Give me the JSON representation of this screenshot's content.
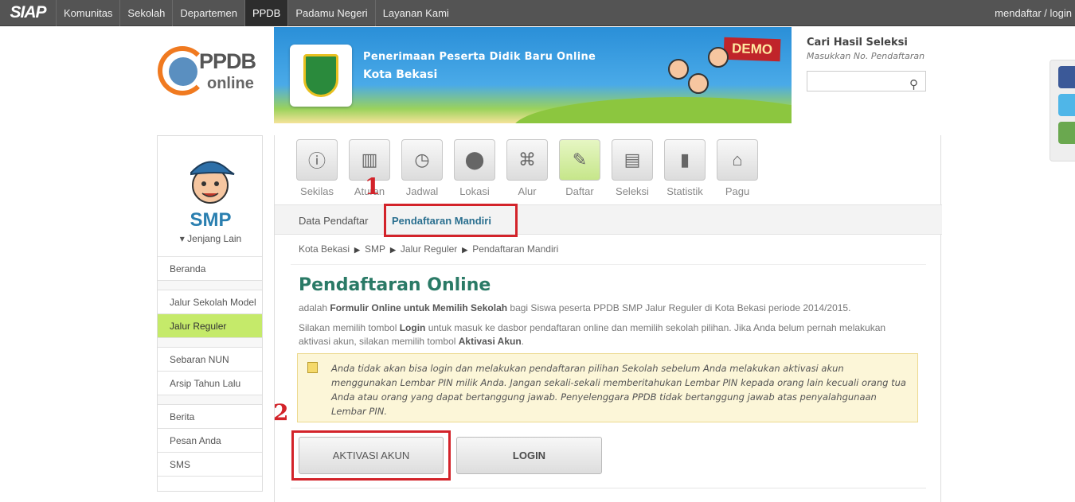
{
  "topnav": {
    "logo": "SIAP",
    "items": [
      "Komunitas",
      "Sekolah",
      "Departemen",
      "PPDB",
      "Padamu Negeri",
      "Layanan Kami"
    ],
    "active": "PPDB",
    "user_links": "mendaftar / login"
  },
  "brand": {
    "ppdb": "PPDB",
    "online": "online"
  },
  "banner": {
    "title": "Penerimaan Peserta Didik Baru Online",
    "city": "Kota Bekasi",
    "badge": "DEMO"
  },
  "search": {
    "title": "Cari Hasil Seleksi",
    "subtitle": "Masukkan No. Pendaftaran",
    "value": ""
  },
  "sidebar": {
    "level": "SMP",
    "switch_label": "Jenjang Lain",
    "groups": [
      [
        "Beranda"
      ],
      [
        "Jalur Sekolah Model",
        "Jalur Reguler"
      ],
      [
        "Sebaran NUN",
        "Arsip Tahun Lalu"
      ],
      [
        "Berita",
        "Pesan Anda",
        "SMS"
      ]
    ],
    "active": "Jalur Reguler"
  },
  "toolbar": {
    "items": [
      {
        "label": "Sekilas",
        "icon": "info-icon"
      },
      {
        "label": "Aturan",
        "icon": "book-icon"
      },
      {
        "label": "Jadwal",
        "icon": "clock-icon"
      },
      {
        "label": "Lokasi",
        "icon": "map-pin-icon"
      },
      {
        "label": "Alur",
        "icon": "flow-icon"
      },
      {
        "label": "Daftar",
        "icon": "pencil-icon"
      },
      {
        "label": "Seleksi",
        "icon": "clipboard-icon"
      },
      {
        "label": "Statistik",
        "icon": "bar-chart-icon"
      },
      {
        "label": "Pagu",
        "icon": "home-icon"
      }
    ],
    "active": "Daftar"
  },
  "subtabs": {
    "items": [
      "Data Pendaftar",
      "Pendaftaran Mandiri"
    ],
    "active": "Pendaftaran Mandiri"
  },
  "breadcrumb": [
    "Kota Bekasi",
    "SMP",
    "Jalur Reguler",
    "Pendaftaran Mandiri"
  ],
  "content": {
    "title": "Pendaftaran Online",
    "intro_pre": "adalah ",
    "intro_bold": "Formulir Online untuk Memilih Sekolah",
    "intro_post": " bagi Siswa peserta PPDB SMP Jalur Reguler di Kota Bekasi periode 2014/2015.",
    "p2_a": "Silakan memilih tombol ",
    "p2_login": "Login",
    "p2_b": " untuk masuk ke dasbor pendaftaran online dan memilih sekolah pilihan. Jika Anda belum pernah melakukan aktivasi akun, silakan memilih tombol ",
    "p2_activate": "Aktivasi Akun",
    "p2_c": ".",
    "note": "Anda tidak akan bisa login dan melakukan pendaftaran pilihan Sekolah sebelum Anda melakukan aktivasi akun menggunakan Lembar PIN milik Anda. Jangan sekali-sekali memberitahukan Lembar PIN kepada orang lain kecuali orang tua Anda atau orang yang dapat bertanggung jawab. Penyelenggara PPDB tidak bertanggung jawab atas penyalahgunaan Lembar PIN.",
    "activate_button": "AKTIVASI AKUN",
    "login_button": "LOGIN"
  },
  "annotations": {
    "step1": "1",
    "step2": "2",
    "color": "#d3232a"
  }
}
